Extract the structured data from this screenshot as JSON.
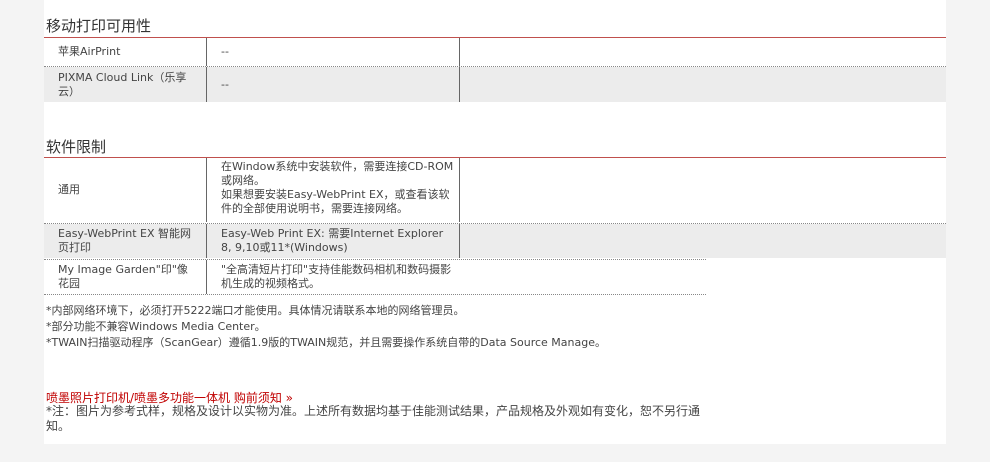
{
  "mobile_print": {
    "title": "移动打印可用性",
    "rows": [
      {
        "label": "苹果AirPrint",
        "value": "--"
      },
      {
        "label": "PIXMA Cloud Link（乐享云）",
        "value": "--"
      }
    ]
  },
  "software": {
    "title": "软件限制",
    "rows": [
      {
        "label": "通用",
        "value": "在Window系统中安装软件，需要连接CD-ROM或网络。\n如果想要安装Easy-WebPrint EX，或查看该软件的全部使用说明书，需要连接网络。"
      },
      {
        "label": "Easy-WebPrint EX 智能网页打印",
        "value": "Easy-Web Print EX: 需要Internet Explorer 8, 9,10或11*(Windows)"
      },
      {
        "label": "My Image Garden\"印\"像花园",
        "value": "\"全高清短片打印\"支持佳能数码相机和数码摄影机生成的视频格式。"
      }
    ]
  },
  "notes": [
    "*内部网络环境下，必须打开5222端口才能使用。具体情况请联系本地的网络管理员。",
    "*部分功能不兼容Windows Media Center。",
    "*TWAIN扫描驱动程序（ScanGear）遵循1.9版的TWAIN规范，并且需要操作系统自带的Data Source Manage。"
  ],
  "purchase_link": "喷墨照片打印机/喷墨多功能一体机 购前须知 »",
  "disclaimer": "*注：图片为参考式样，规格及设计以实物为准。上述所有数据均基于佳能测试结果，产品规格及外观如有变化，恕不另行通知。"
}
